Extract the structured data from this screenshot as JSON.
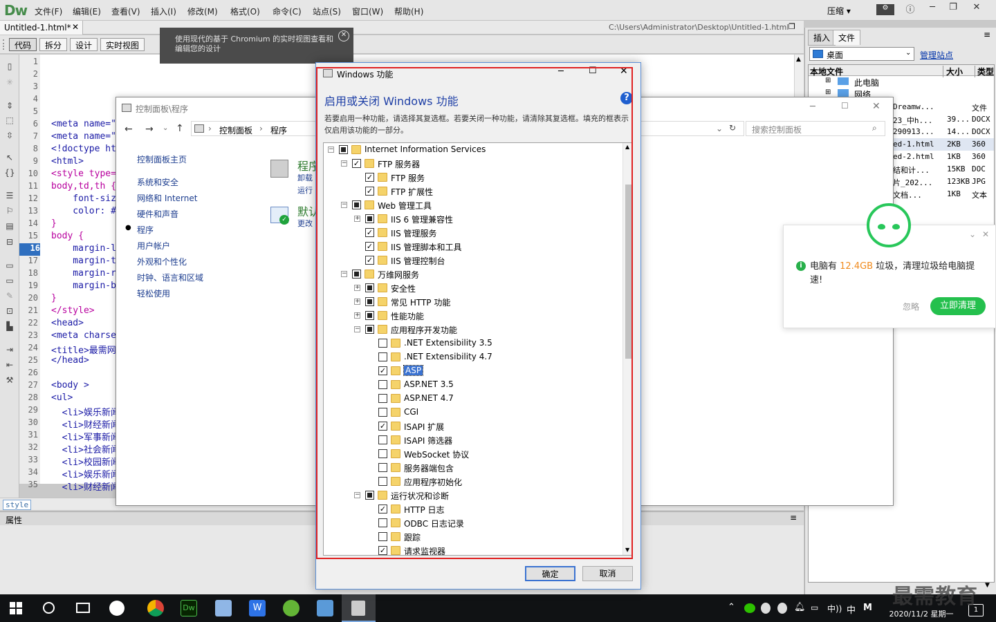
{
  "dw": {
    "logo": "Dw",
    "menu": [
      "文件(F)",
      "编辑(E)",
      "查看(V)",
      "插入(I)",
      "修改(M)",
      "格式(O)",
      "命令(C)",
      "站点(S)",
      "窗口(W)",
      "帮助(H)"
    ],
    "compress": "压缩",
    "doc_tab": "Untitled-1.html*",
    "doc_path": "C:\\Users\\Administrator\\Desktop\\Untitled-1.html",
    "views": [
      "代码",
      "拆分",
      "设计",
      "实时视图"
    ],
    "chromium_tip": "使用现代的基于 Chromium 的实时视图查看和编辑您的设计",
    "current_line": "16",
    "code_lines": [
      {
        "n": "1",
        "t": "",
        "c": "#000"
      },
      {
        "n": "2",
        "t": "",
        "c": "#000"
      },
      {
        "n": "3",
        "t": "",
        "c": "#000"
      },
      {
        "n": "4",
        "t": "",
        "c": "#000"
      },
      {
        "n": "5",
        "t": "",
        "c": "#000"
      },
      {
        "n": "6",
        "t": "<meta name=\"",
        "c": "#1a1aa6"
      },
      {
        "n": "7",
        "t": "<meta name=\"",
        "c": "#1a1aa6"
      },
      {
        "n": "8",
        "t": "<!doctype ht",
        "c": "#1a1aa6"
      },
      {
        "n": "9",
        "t": "<html>",
        "c": "#1a1aa6"
      },
      {
        "n": "10",
        "t": "<style type=",
        "c": "#b8009e"
      },
      {
        "n": "11",
        "t": "body,td,th {",
        "c": "#b8009e"
      },
      {
        "n": "12",
        "t": "    font-siz",
        "c": "#1a1aa6"
      },
      {
        "n": "13",
        "t": "    color: #",
        "c": "#1a1aa6"
      },
      {
        "n": "14",
        "t": "}",
        "c": "#b8009e"
      },
      {
        "n": "15",
        "t": "body {",
        "c": "#b8009e"
      },
      {
        "n": "16",
        "t": "    margin-l",
        "c": "#1a1aa6"
      },
      {
        "n": "17",
        "t": "    margin-t",
        "c": "#1a1aa6"
      },
      {
        "n": "18",
        "t": "    margin-r",
        "c": "#1a1aa6"
      },
      {
        "n": "19",
        "t": "    margin-b",
        "c": "#1a1aa6"
      },
      {
        "n": "20",
        "t": "}",
        "c": "#b8009e"
      },
      {
        "n": "21",
        "t": "</style>",
        "c": "#b8009e"
      },
      {
        "n": "22",
        "t": "<head>",
        "c": "#1a1aa6"
      },
      {
        "n": "23",
        "t": "<meta charse",
        "c": "#1a1aa6"
      },
      {
        "n": "24",
        "t": "<title>最需网",
        "c": "#1a1aa6"
      },
      {
        "n": "25",
        "t": "</head>",
        "c": "#1a1aa6"
      },
      {
        "n": "26",
        "t": "",
        "c": "#000"
      },
      {
        "n": "27",
        "t": "<body >",
        "c": "#1a1aa6"
      },
      {
        "n": "28",
        "t": "<ul>",
        "c": "#1a1aa6"
      },
      {
        "n": "29",
        "t": "  <li>娱乐新闻",
        "c": "#1a1aa6"
      },
      {
        "n": "30",
        "t": "  <li>财经新闻",
        "c": "#1a1aa6"
      },
      {
        "n": "31",
        "t": "  <li>军事新闻",
        "c": "#1a1aa6"
      },
      {
        "n": "32",
        "t": "  <li>社会新闻",
        "c": "#1a1aa6"
      },
      {
        "n": "33",
        "t": "  <li>校园新闻",
        "c": "#1a1aa6"
      },
      {
        "n": "34",
        "t": "  <li>娱乐新闻",
        "c": "#1a1aa6"
      },
      {
        "n": "35",
        "t": "  <li>财经新闻",
        "c": "#1a1aa6"
      }
    ],
    "tag_selector": "style",
    "properties": "属性"
  },
  "right_panel": {
    "tabs": [
      "插入",
      "文件"
    ],
    "site": "桌面",
    "manage": "管理站点",
    "header": {
      "name": "本地文件",
      "size": "大小",
      "type": "类型"
    },
    "tree": [
      "此电脑",
      "网络"
    ],
    "files": [
      {
        "name": "Dreamw...",
        "size": "",
        "type": "文件"
      },
      {
        "name": "23_中h...",
        "size": "39...",
        "type": "DOCX"
      },
      {
        "name": "290913...",
        "size": "14...",
        "type": "DOCX"
      },
      {
        "name": "ed-1.html",
        "size": "2KB",
        "type": "360"
      },
      {
        "name": "ed-2.html",
        "size": "1KB",
        "type": "360"
      },
      {
        "name": "结和计...",
        "size": "15KB",
        "type": "DOC"
      },
      {
        "name": "片_202...",
        "size": "123KB",
        "type": "JPG"
      },
      {
        "name": "文档...",
        "size": "1KB",
        "type": "文本"
      }
    ]
  },
  "control_panel": {
    "title": "控制面板\\程序",
    "breadcrumb": [
      "控制面板",
      "程序"
    ],
    "search_placeholder": "搜索控制面板",
    "nav": [
      "控制面板主页",
      "系统和安全",
      "网络和 Internet",
      "硬件和声音",
      "程序",
      "用户帐户",
      "外观和个性化",
      "时钟、语言和区域",
      "轻松使用"
    ],
    "selected_nav": "程序",
    "sections": [
      {
        "title": "程序",
        "links": [
          "卸载",
          "运行"
        ]
      },
      {
        "title": "默认",
        "links": [
          "更改"
        ]
      }
    ]
  },
  "features": {
    "title": "Windows 功能",
    "heading": "启用或关闭 Windows 功能",
    "description": "若要启用一种功能，请选择其复选框。若要关闭一种功能，请清除其复选框。填充的框表示仅启用该功能的一部分。",
    "ok": "确定",
    "cancel": "取消",
    "nodes": [
      {
        "label": "Internet Information Services",
        "level": 0,
        "exp": "-",
        "state": "partial"
      },
      {
        "label": "FTP 服务器",
        "level": 1,
        "exp": "-",
        "state": "checked"
      },
      {
        "label": "FTP 服务",
        "level": 2,
        "exp": "",
        "state": "checked"
      },
      {
        "label": "FTP 扩展性",
        "level": 2,
        "exp": "",
        "state": "checked"
      },
      {
        "label": "Web 管理工具",
        "level": 1,
        "exp": "-",
        "state": "partial"
      },
      {
        "label": "IIS 6 管理兼容性",
        "level": 2,
        "exp": "+",
        "state": "partial"
      },
      {
        "label": "IIS 管理服务",
        "level": 2,
        "exp": "",
        "state": "checked"
      },
      {
        "label": "IIS 管理脚本和工具",
        "level": 2,
        "exp": "",
        "state": "checked"
      },
      {
        "label": "IIS 管理控制台",
        "level": 2,
        "exp": "",
        "state": "checked"
      },
      {
        "label": "万维网服务",
        "level": 1,
        "exp": "-",
        "state": "partial"
      },
      {
        "label": "安全性",
        "level": 2,
        "exp": "+",
        "state": "partial"
      },
      {
        "label": "常见 HTTP 功能",
        "level": 2,
        "exp": "+",
        "state": "partial"
      },
      {
        "label": "性能功能",
        "level": 2,
        "exp": "+",
        "state": "partial"
      },
      {
        "label": "应用程序开发功能",
        "level": 2,
        "exp": "-",
        "state": "partial"
      },
      {
        "label": ".NET Extensibility 3.5",
        "level": 3,
        "exp": "",
        "state": "empty"
      },
      {
        "label": ".NET Extensibility 4.7",
        "level": 3,
        "exp": "",
        "state": "empty"
      },
      {
        "label": "ASP",
        "level": 3,
        "exp": "",
        "state": "checked",
        "selected": true
      },
      {
        "label": "ASP.NET 3.5",
        "level": 3,
        "exp": "",
        "state": "empty"
      },
      {
        "label": "ASP.NET 4.7",
        "level": 3,
        "exp": "",
        "state": "empty"
      },
      {
        "label": "CGI",
        "level": 3,
        "exp": "",
        "state": "empty"
      },
      {
        "label": "ISAPI 扩展",
        "level": 3,
        "exp": "",
        "state": "checked"
      },
      {
        "label": "ISAPI 筛选器",
        "level": 3,
        "exp": "",
        "state": "empty"
      },
      {
        "label": "WebSocket 协议",
        "level": 3,
        "exp": "",
        "state": "empty"
      },
      {
        "label": "服务器端包含",
        "level": 3,
        "exp": "",
        "state": "empty"
      },
      {
        "label": "应用程序初始化",
        "level": 3,
        "exp": "",
        "state": "empty"
      },
      {
        "label": "运行状况和诊断",
        "level": 2,
        "exp": "-",
        "state": "partial"
      },
      {
        "label": "HTTP 日志",
        "level": 3,
        "exp": "",
        "state": "checked"
      },
      {
        "label": "ODBC 日志记录",
        "level": 3,
        "exp": "",
        "state": "empty"
      },
      {
        "label": "跟踪",
        "level": 3,
        "exp": "",
        "state": "empty"
      },
      {
        "label": "请求监视器",
        "level": 3,
        "exp": "",
        "state": "checked"
      }
    ]
  },
  "cleaner": {
    "message_pre": "电脑有 ",
    "size": "12.4GB",
    "message_post": " 垃圾，清理垃圾给电脑提速!",
    "ignore": "忽略",
    "clean_now": "立即清理"
  },
  "taskbar": {
    "ime": "中",
    "date": "2020/11/2 星期一",
    "notification_count": "1",
    "volume_label": "中))",
    "m_label": "M"
  },
  "watermark": "最需教育"
}
